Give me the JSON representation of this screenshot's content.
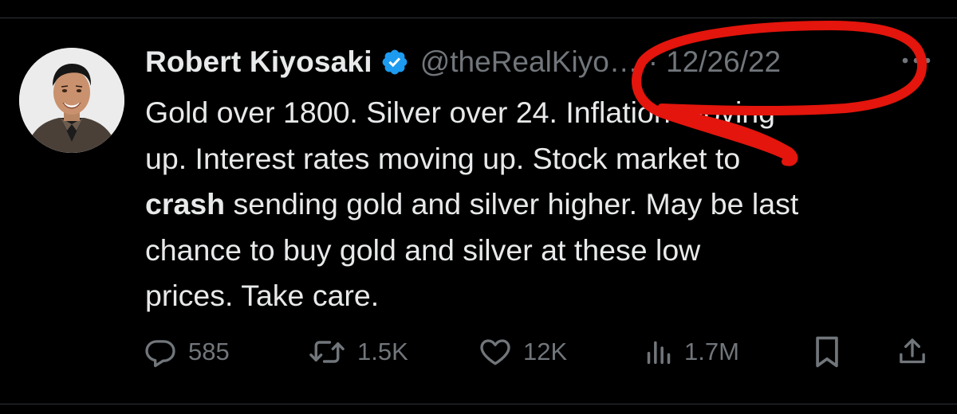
{
  "tweet": {
    "author": {
      "display_name": "Robert Kiyosaki",
      "handle": "@theRealKiyo…",
      "verified": true,
      "avatar_icon": "profile-photo"
    },
    "separator": "·",
    "date": "12/26/22",
    "text": {
      "line1": "Gold over 1800. Silver over 24. Inflation moving",
      "line2": "up. Interest rates moving up. Stock market to",
      "line3_bold": "crash",
      "line3_rest": " sending gold and silver higher. May be last",
      "line4": "chance to buy gold and silver at these low",
      "line5": "prices. Take care."
    },
    "stats": {
      "replies": "585",
      "retweets": "1.5K",
      "likes": "12K",
      "views": "1.7M"
    }
  },
  "colors": {
    "background": "#000000",
    "text_primary": "#e7e9ea",
    "text_secondary": "#71767b",
    "verified_blue": "#1d9bf0",
    "annotation_red": "#e3150c"
  },
  "icons": {
    "verified": "verified-badge-icon",
    "more": "more-icon",
    "reply": "reply-icon",
    "retweet": "retweet-icon",
    "like": "heart-icon",
    "views": "views-icon",
    "bookmark": "bookmark-icon",
    "share": "share-icon"
  }
}
